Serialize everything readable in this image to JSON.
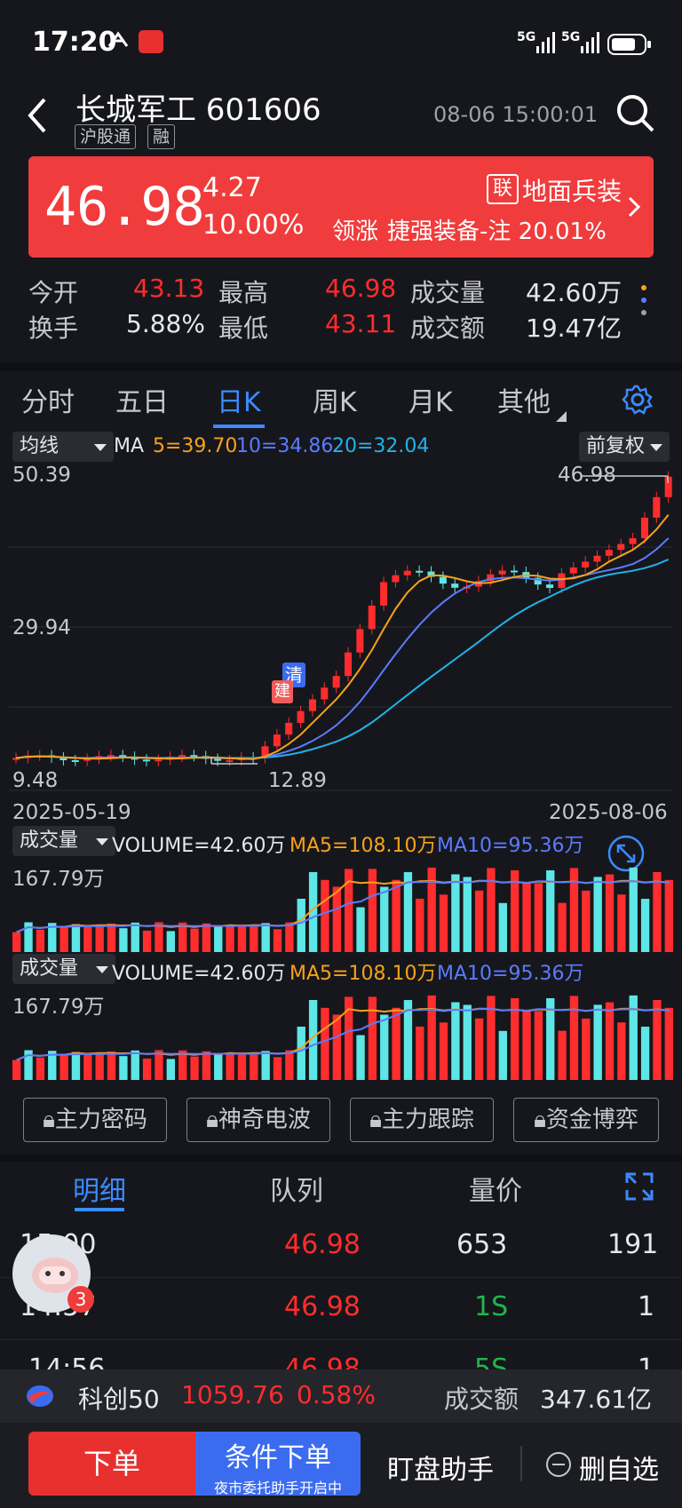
{
  "status": {
    "time": "17:20",
    "net1": "5G",
    "net2": "5G"
  },
  "header": {
    "name": "长城军工 601606",
    "tags": [
      "沪股通",
      "融"
    ],
    "datetime": "08-06 15:00:01"
  },
  "quote": {
    "price": "46.98",
    "change": "4.27",
    "change_pct": "10.00%",
    "sector_badge": "联",
    "sector": "地面兵装",
    "leader_label": "领涨",
    "leader": "捷强装备-注 20.01%"
  },
  "stats": [
    {
      "label": "今开",
      "value": "43.13"
    },
    {
      "label": "最高",
      "value": "46.98"
    },
    {
      "label": "成交量",
      "value": "42.60万"
    },
    {
      "label": "换手",
      "value": "5.88%"
    },
    {
      "label": "最低",
      "value": "43.11"
    },
    {
      "label": "成交额",
      "value": "19.47亿"
    }
  ],
  "tabs": [
    "分时",
    "五日",
    "日K",
    "周K",
    "月K",
    "其他"
  ],
  "active_tab": "日K",
  "kline": {
    "indicator": "均线",
    "ma_label": "MA",
    "ma5": "5=39.70",
    "ma10": "10=34.86",
    "ma20": "20=32.04",
    "adjust": "前复权",
    "y_top": "50.39",
    "y_mid": "29.94",
    "y_bottom": "9.48",
    "high_mark": "46.98",
    "low_mark": "12.89",
    "badge1": "清",
    "badge2": "建",
    "date_start": "2025-05-19",
    "date_end": "2025-08-06"
  },
  "volume": {
    "label": "成交量",
    "volume_text": "VOLUME=42.60万",
    "ma5_text": "MA5=108.10万",
    "ma10_text": "MA10=95.36万",
    "max_label": "167.79万"
  },
  "features": [
    "主力密码",
    "神奇电波",
    "主力跟踪",
    "资金博弈"
  ],
  "detail_tabs": [
    "明细",
    "队列",
    "量价"
  ],
  "trades": [
    {
      "time": "15:00",
      "price": "46.98",
      "vol": "653",
      "count": "191"
    },
    {
      "time": "14:57",
      "price": "46.98",
      "vol": "1S",
      "count": "1"
    },
    {
      "time": "14:56",
      "price": "46.98",
      "vol": "5S",
      "count": "1"
    }
  ],
  "mascot_badge": "3",
  "index_bar": {
    "name": "科创50",
    "value": "1059.76",
    "pct": "0.58%",
    "turnover_label": "成交额",
    "turnover": "347.61亿"
  },
  "actions": {
    "order": "下单",
    "cond_order": "条件下单",
    "cond_sub": "夜市委托助手开启中",
    "assistant": "盯盘助手",
    "remove": "删自选"
  },
  "colors": {
    "up": "#ff2d2d",
    "down": "#5ee6e6",
    "ma5": "#f7a21b",
    "ma10": "#5b7bff",
    "ma20": "#20b4ea",
    "accent": "#3b8bff"
  }
}
